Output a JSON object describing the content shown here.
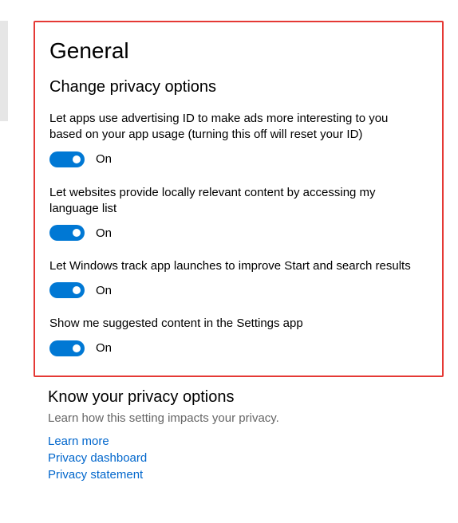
{
  "page_title": "General",
  "section_title": "Change privacy options",
  "settings": [
    {
      "desc": "Let apps use advertising ID to make ads more interesting to you based on your app usage (turning this off will reset your ID)",
      "state": "On"
    },
    {
      "desc": "Let websites provide locally relevant content by accessing my language list",
      "state": "On"
    },
    {
      "desc": "Let Windows track app launches to improve Start and search results",
      "state": "On"
    },
    {
      "desc": "Show me suggested content in the Settings app",
      "state": "On"
    }
  ],
  "below": {
    "title": "Know your privacy options",
    "desc": "Learn how this setting impacts your privacy.",
    "links": {
      "learn_more": "Learn more",
      "dashboard": "Privacy dashboard",
      "statement": "Privacy statement"
    }
  }
}
